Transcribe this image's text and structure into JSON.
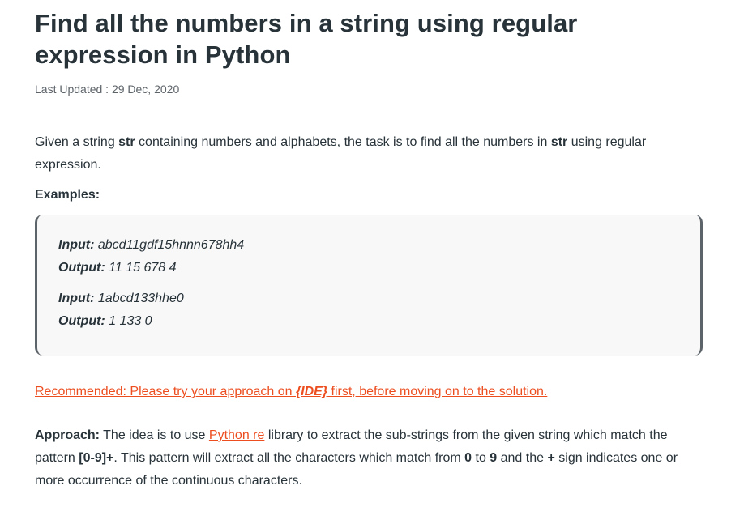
{
  "article": {
    "title": "Find all the numbers in a string using regular expression in Python",
    "last_updated": "Last Updated : 29 Dec, 2020",
    "intro": {
      "t1": "Given a string ",
      "b1": "str",
      "t2": " containing numbers and alphabets, the task is to find all the numbers in ",
      "b2": "str",
      "t3": " using regular expression."
    },
    "examples_label": "Examples:",
    "examples": [
      {
        "input_label": "Input:",
        "input_value": " abcd11gdf15hnnn678hh4",
        "output_label": "Output:",
        "output_value": " 11 15 678 4"
      },
      {
        "input_label": "Input:",
        "input_value": " 1abcd133hhe0",
        "output_label": "Output:",
        "output_value": " 1 133 0"
      }
    ],
    "recommended": {
      "before": "Recommended: Please try your approach on ",
      "ide": "{IDE}",
      "after": " first, before moving on to the solution."
    },
    "approach": {
      "label": "Approach:",
      "t1": " The idea is to use ",
      "link": "Python re",
      "t2": " library to extract the sub-strings from the given string which match the pattern ",
      "pattern": "[0-9]+",
      "t3": ". This pattern will extract all the characters which match from ",
      "zero": "0",
      "t4": " to ",
      "nine": "9",
      "t5": " and the ",
      "plus": "+",
      "t6": " sign indicates one or more occurrence of the continuous characters."
    }
  },
  "colors": {
    "text": "#273239",
    "muted": "#5c6369",
    "link": "#ec4e20",
    "box_bg": "#f8f8f8"
  }
}
